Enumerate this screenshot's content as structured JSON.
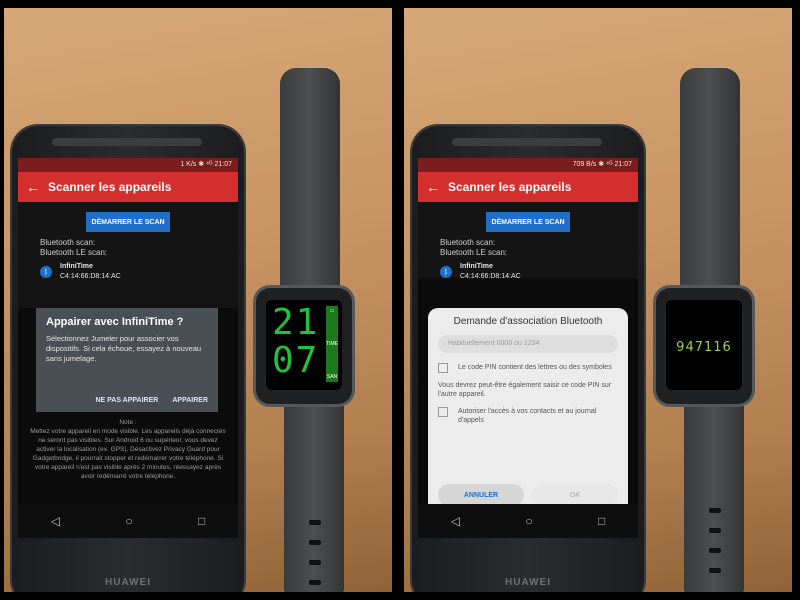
{
  "left": {
    "phone": {
      "status": "1 K/s ✱ ⁴ᴳ  21:07",
      "appbar": {
        "back": "←",
        "title": "Scanner les appareils"
      },
      "scan_button": "DÉMARRER LE SCAN",
      "bt_scan": "Bluetooth scan:",
      "ble_scan": "Bluetooth LE scan:",
      "device": {
        "name": "InfiniTime",
        "address": "C4:14:66:D8:14:AC",
        "icon": "bluetooth-icon"
      },
      "dialog": {
        "title": "Appairer avec InfiniTime ?",
        "body": "Sélectionnez Jumeler pour associer vos dispositifs. Si cela échoue, essayez à nouveau sans jumelage.",
        "negative": "NE PAS APPAIRER",
        "positive": "APPAIRER"
      },
      "note_title": "Note :",
      "note_body": "Mettez votre appareil en mode visible. Les appareils déjà connectés ne seront pas visibles. Sur Android 6 ou supérieur, vous devez activer la localisation (ex. GPS). Désactivez Privacy Guard pour Gadgetbridge, il pourrait stopper et redémarrer votre téléphone. Si votre appareil n'est pas visible après 2 minutes, réessayez après avoir redémarré votre téléphone.",
      "brand": "HUAWEI"
    },
    "watch": {
      "hours": "21",
      "minutes": "07",
      "side": {
        "top": "▭",
        "mid": "TIME",
        "bottom": "SAN"
      }
    }
  },
  "right": {
    "phone": {
      "status": "709 B/s ✱ ⁴ᴳ  21:07",
      "appbar": {
        "back": "←",
        "title": "Scanner les appareils"
      },
      "scan_button": "DÉMARRER LE SCAN",
      "bt_scan": "Bluetooth scan:",
      "ble_scan": "Bluetooth LE scan:",
      "device": {
        "name": "InfiniTime",
        "address": "C4:14:66:D8:14:AC",
        "icon": "bluetooth-icon"
      },
      "bt_dialog": {
        "title": "Demande d'association Bluetooth",
        "placeholder": "Habituellement 0000 ou 1234",
        "check_pin": "Le code PIN contient des lettres ou des symboles",
        "note": "Vous devrez peut-être également saisir ce code PIN sur l'autre appareil.",
        "check_contacts": "Autoriser l'accès à vos contacts et au journal d'appels",
        "cancel": "ANNULER",
        "ok": "OK"
      },
      "brand": "HUAWEI"
    },
    "watch": {
      "pin": "947116"
    }
  },
  "navbar": {
    "back": "◁",
    "home": "○",
    "recent": "□"
  }
}
